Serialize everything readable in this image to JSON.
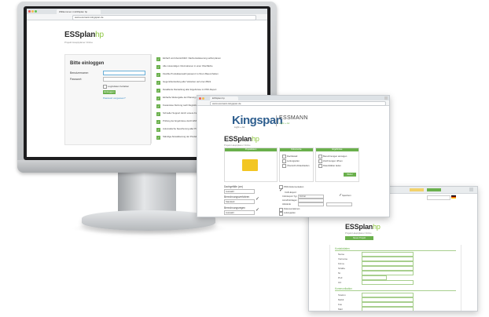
{
  "monitor": {
    "tabs": [
      "Willkommen in ESSplan hp"
    ],
    "url": "www.essmann-kingspan.de",
    "logo_main": "ESSplan",
    "logo_hp": "hp",
    "logo_sub": "Projekt Hauptplaner Online",
    "login": {
      "title": "Bitte einloggen",
      "username_label": "Benutzername:",
      "password_label": "Passwort:",
      "remember_label": "Logindaten behalten",
      "login_button": "Einloggen",
      "forgot_link": "Passwort vergessen?"
    },
    "features": [
      "Einfach und übersichtlich: Dachentwässerung selbst planen",
      "Alle notwendigen Informationen in einer Oberfläche",
      "Flexible Produktauswahl passend zu Ihrem Bauvorhaben",
      "Gegenüberstellung aller Varianten auf einen Blick",
      "Detaillierte Darstellung aller Ergebnisse im PDF-Report",
      "Einfache Weitergabe der Planung an Kunden und Partner",
      "Kostenlose Nutzung nach Registrierung",
      "Schneller Support durch unsere Fachberater",
      "Prüfung der Ergebnisse durch ESSMANN Experten",
      "Automatische Speicherung aller Projekte",
      "Ständige Aktualisierung der Produktdaten"
    ]
  },
  "window2": {
    "tabs": [
      "ESSplan hp"
    ],
    "url": "www.essmann-kingspan.de",
    "kingspan": "Kingspan",
    "kingspan_sub": "Light + Air",
    "essmann": "ESSMANN",
    "essmann_sub": "Light + Air",
    "logo_main": "ESSplan",
    "logo_hp": "hp",
    "logo_sub": "Projekt Hauptplaner Online",
    "col_headers": [
      "Projektdaten",
      "Dokumente",
      "Ergebnisse"
    ],
    "doc_items": [
      "Dachdetail",
      "Leitungsplan",
      "Übersicht Ablaufstellen"
    ],
    "result_items": [
      "Berechnungen anzeigen",
      "Zeichnungen öffnen",
      "Datenblätter laden"
    ],
    "next_button": "Weiter",
    "left_form": {
      "label1": "Dachgefälle (cm)",
      "select1": "Auswahl",
      "label2": "Berechnungsverfahren",
      "select2": "Standard",
      "label3": "Berechnungsregen",
      "select3": "Auswahl"
    },
    "right_form": {
      "pdf_label": "PDF-Dokumentation",
      "cad_label": "CAD-Export",
      "row1_label": "CAD-Export Typ",
      "row1_value": "Format",
      "row2_label": "Anzahl Einlagen",
      "row3_label": "Abstände",
      "save_label": "Speichern",
      "list": [
        "Dokumentationen",
        "Leitungsplan",
        "Planungsdetails",
        "Stückliste",
        "Massenberechnung"
      ]
    }
  },
  "window3": {
    "logo_main": "ESSplan",
    "logo_hp": "hp",
    "logo_sub": "Projekt Hauptplaner Online",
    "green_button": "Neues Projekt",
    "section1": "Kontaktdaten",
    "fields1": [
      "Name",
      "Vorname",
      "Firma",
      "Straße",
      "Nr.",
      "PLZ",
      "Ort"
    ],
    "section2": "Kommunikation",
    "fields2": [
      "Telefon",
      "Mobil",
      "Fax",
      "Mail"
    ]
  },
  "colors": {
    "accent": "#6ab04c",
    "kingspan_blue": "#2f5f8f",
    "folder": "#f3c623"
  }
}
